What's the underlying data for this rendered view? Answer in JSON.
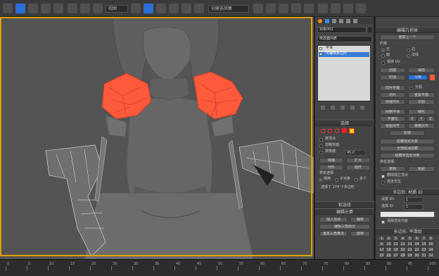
{
  "toolbar": {
    "selection_set_value": "创建选择集",
    "view_dropdown": "视图",
    "colors": {
      "accent": "#2b6fd6",
      "highlight": "#ff5a3c"
    }
  },
  "viewport": {
    "selection_color": "#ff5a3c",
    "frame_color": "#e0a000"
  },
  "modifier_panel": {
    "object_name": "对象002",
    "modifier_list": "修改器列表",
    "stack_items": [
      {
        "label": "平滑",
        "icon": "bulb-icon"
      },
      {
        "label": "可编辑多边形",
        "icon": "bulb-icon",
        "selected": true
      }
    ],
    "selection_title": "选择",
    "by_vertex": "按顶点",
    "ignore_backfacing": "忽略背面",
    "by_angle": "按角度:",
    "angle_value": "45.0",
    "shrink": "收缩",
    "grow": "扩大",
    "ring": "环形",
    "loop": "循环",
    "preview_title": "预览选择",
    "preview_off": "禁用",
    "preview_subobj": "子对象",
    "preview_multi": "多个",
    "selection_count": "选择了 274 个多边形",
    "soft_selection_title": "软选择",
    "edit_elements_title": "编辑元素",
    "insert_vertex": "插入顶点",
    "flip": "翻转",
    "edit_triangulation": "编辑三角剖分",
    "retriangulate": "重复三角算法",
    "rotate": "旋转"
  },
  "geometry_panel": {
    "title": "编辑几何体",
    "repeat_last": "重复上一个",
    "constraints": "约束",
    "c_none": "无",
    "c_edge": "边",
    "c_face": "面",
    "c_normal": "法线",
    "preserve_uvs": "保持 UV",
    "create": "创建",
    "collapse": "塌陷",
    "attach": "附加",
    "detach": "分离",
    "slice_plane": "切片平面",
    "split": "分割",
    "slice": "切片",
    "reset_plane": "重置平面",
    "quickslice": "快速切片",
    "cut": "切割",
    "meshsmooth": "网格平滑",
    "tessellate": "细化",
    "make_planar": "平面化",
    "x": "X",
    "y": "Y",
    "z": "Z",
    "view_align": "视图对齐",
    "grid_align": "栅格对齐",
    "relax": "松弛",
    "hide_selected": "隐藏选定对象",
    "unhide_all": "全部取消隐藏",
    "hide_unselected": "隐藏未选定对象",
    "named_selections": "命名选择:",
    "copy": "复制",
    "paste": "粘贴",
    "delete_isolated": "删除孤立顶点",
    "full_interactivity": "完全交互",
    "material_ids_title": "多边形: 材质 ID",
    "set_id": "设置 ID:",
    "set_id_val": "1",
    "select_id": "选择 ID",
    "select_id_val": "1",
    "clear_selection": "清除选定内容",
    "smoothing_groups_title": "多边形: 平滑组",
    "smoothing_numbers": [
      "1",
      "2",
      "3",
      "4",
      "5",
      "6",
      "7",
      "8",
      "9",
      "10",
      "11",
      "12",
      "13",
      "14",
      "15",
      "16",
      "17",
      "18",
      "19",
      "20",
      "21",
      "22",
      "23",
      "24",
      "25",
      "26",
      "27",
      "28",
      "29",
      "30",
      "31",
      "32"
    ]
  },
  "timeline": {
    "ticks": [
      "0",
      "5",
      "10",
      "15",
      "20",
      "25",
      "30",
      "35",
      "40",
      "45",
      "50",
      "55",
      "60",
      "65",
      "70",
      "75",
      "80",
      "85",
      "90",
      "95",
      "100"
    ]
  }
}
